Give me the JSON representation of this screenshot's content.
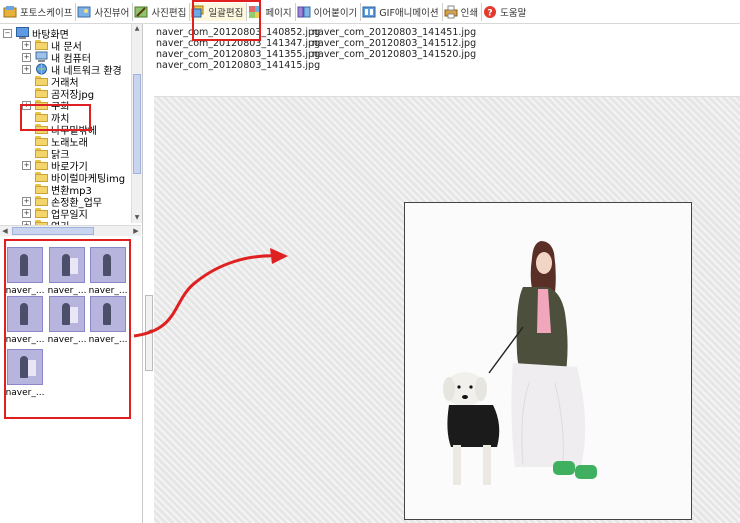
{
  "toolbar": {
    "items": [
      {
        "label": "포토스케이프",
        "icon": "photoscape-icon"
      },
      {
        "label": "사진뷰어",
        "icon": "viewer-icon"
      },
      {
        "label": "사진편집",
        "icon": "editor-icon"
      },
      {
        "label": "일괄편집",
        "icon": "batch-edit-icon",
        "active": true
      },
      {
        "label": "페이지",
        "icon": "page-icon"
      },
      {
        "label": "이어붙이기",
        "icon": "combine-icon"
      },
      {
        "label": "GIF애니메이션",
        "icon": "gif-icon"
      },
      {
        "label": "인쇄",
        "icon": "print-icon"
      },
      {
        "label": "도움말",
        "icon": "help-icon"
      }
    ]
  },
  "tree": {
    "root": "바탕화면",
    "items": [
      {
        "label": "내 문서",
        "expand": "+"
      },
      {
        "label": "내 컴퓨터",
        "expand": "+"
      },
      {
        "label": "내 네트워크 환경",
        "expand": "+"
      },
      {
        "label": "거래처",
        "expand": ""
      },
      {
        "label": "곰저장jpg",
        "expand": ""
      },
      {
        "label": "구희",
        "expand": "+"
      },
      {
        "label": "까치",
        "expand": "",
        "selected": true
      },
      {
        "label": "나무밑밖에",
        "expand": ""
      },
      {
        "label": "노래노래",
        "expand": ""
      },
      {
        "label": "닭크",
        "expand": ""
      },
      {
        "label": "바로가기",
        "expand": "+"
      },
      {
        "label": "바이럴마케팅img",
        "expand": ""
      },
      {
        "label": "변환mp3",
        "expand": ""
      },
      {
        "label": "손정환_업무",
        "expand": "+"
      },
      {
        "label": "업무일지",
        "expand": "+"
      },
      {
        "label": "연기",
        "expand": "+"
      }
    ]
  },
  "thumbnails": {
    "caption": "naver_...",
    "count": 7
  },
  "files": [
    "naver_com_20120803_140852.jpg",
    "naver_com_20120803_141451.jpg",
    "naver_com_20120803_141347.jpg",
    "naver_com_20120803_141512.jpg",
    "naver_com_20120803_141355.jpg",
    "naver_com_20120803_141520.jpg",
    "naver_com_20120803_141415.jpg"
  ],
  "colors": {
    "highlight": "#e02020",
    "arrow": "#e02020",
    "thumb": "#b7b4dd"
  }
}
